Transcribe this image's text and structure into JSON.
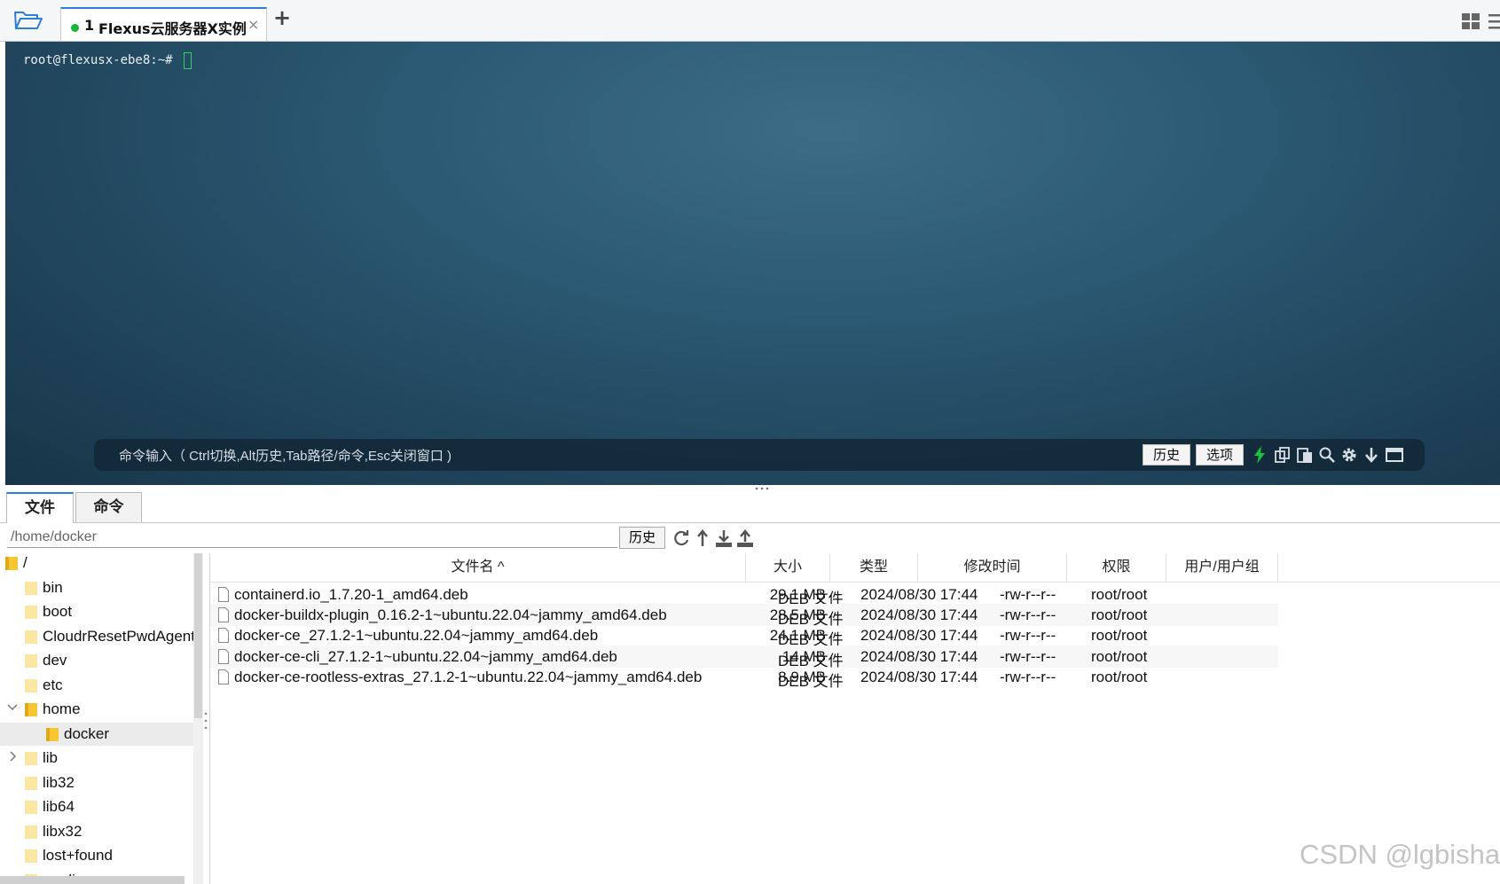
{
  "tabs": [
    {
      "number": "1",
      "title": "Flexus云服务器X实例",
      "close": "×",
      "status_color": "#17b53a"
    }
  ],
  "tab_add_label": "+",
  "terminal": {
    "prompt": "root@flexusx-ebe8:~#",
    "command_placeholder": "命令输入（ Ctrl切换,Alt历史,Tab路径/命令,Esc关闭窗口 )",
    "history_button": "历史",
    "options_button": "选项",
    "tool_icons": [
      "lightning-icon",
      "copy-icon",
      "paste-icon",
      "search-icon",
      "gear-icon",
      "download-arrow-icon",
      "maximize-icon"
    ]
  },
  "panel_tabs": {
    "files": "文件",
    "commands": "命令"
  },
  "path_bar": {
    "path": "/home/docker",
    "history_button": "历史",
    "icons": [
      "refresh-icon",
      "up-dir-icon",
      "download-icon",
      "upload-icon"
    ]
  },
  "tree": [
    {
      "label": "/",
      "depth": 0,
      "toggle": "",
      "selected": false
    },
    {
      "label": "bin",
      "depth": 1,
      "toggle": "",
      "selected": false
    },
    {
      "label": "boot",
      "depth": 1,
      "toggle": "",
      "selected": false
    },
    {
      "label": "CloudrResetPwdAgent",
      "depth": 1,
      "toggle": "",
      "selected": false
    },
    {
      "label": "dev",
      "depth": 1,
      "toggle": "",
      "selected": false
    },
    {
      "label": "etc",
      "depth": 1,
      "toggle": "",
      "selected": false
    },
    {
      "label": "home",
      "depth": 1,
      "toggle": "v",
      "selected": false
    },
    {
      "label": "docker",
      "depth": 2,
      "toggle": "",
      "selected": true
    },
    {
      "label": "lib",
      "depth": 1,
      "toggle": ">",
      "selected": false
    },
    {
      "label": "lib32",
      "depth": 1,
      "toggle": "",
      "selected": false
    },
    {
      "label": "lib64",
      "depth": 1,
      "toggle": "",
      "selected": false
    },
    {
      "label": "libx32",
      "depth": 1,
      "toggle": "",
      "selected": false
    },
    {
      "label": "lost+found",
      "depth": 1,
      "toggle": "",
      "selected": false
    },
    {
      "label": "media",
      "depth": 1,
      "toggle": "",
      "selected": false
    }
  ],
  "table": {
    "headers": {
      "name": "文件名 ^",
      "size": "大小",
      "type": "类型",
      "mtime": "修改时间",
      "perm": "权限",
      "owner": "用户/用户组"
    },
    "rows": [
      {
        "name": "containerd.io_1.7.20-1_amd64.deb",
        "size": "29.1 MB",
        "type": "DEB 文件",
        "mtime": "2024/08/30 17:44",
        "perm": "-rw-r--r--",
        "owner": "root/root"
      },
      {
        "name": "docker-buildx-plugin_0.16.2-1~ubuntu.22.04~jammy_amd64.deb",
        "size": "28.5 MB",
        "type": "DEB 文件",
        "mtime": "2024/08/30 17:44",
        "perm": "-rw-r--r--",
        "owner": "root/root"
      },
      {
        "name": "docker-ce_27.1.2-1~ubuntu.22.04~jammy_amd64.deb",
        "size": "24.1 MB",
        "type": "DEB 文件",
        "mtime": "2024/08/30 17:44",
        "perm": "-rw-r--r--",
        "owner": "root/root"
      },
      {
        "name": "docker-ce-cli_27.1.2-1~ubuntu.22.04~jammy_amd64.deb",
        "size": "14 MB",
        "type": "DEB 文件",
        "mtime": "2024/08/30 17:44",
        "perm": "-rw-r--r--",
        "owner": "root/root"
      },
      {
        "name": "docker-ce-rootless-extras_27.1.2-1~ubuntu.22.04~jammy_amd64.deb",
        "size": "8.9 MB",
        "type": "DEB 文件",
        "mtime": "2024/08/30 17:44",
        "perm": "-rw-r--r--",
        "owner": "root/root"
      }
    ]
  },
  "watermark": "CSDN @lgbisha",
  "colors": {
    "accent": "#2f7ed8",
    "status_green": "#17b53a",
    "lightning_green": "#19c23c"
  }
}
